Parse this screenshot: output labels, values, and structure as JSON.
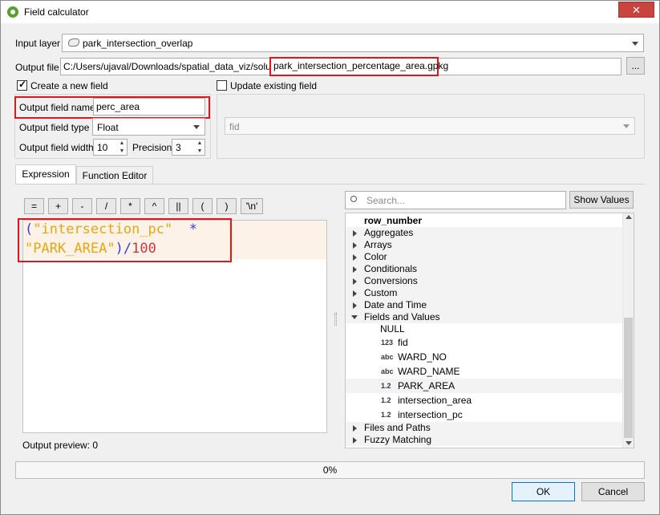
{
  "window": {
    "title": "Field calculator",
    "close_glyph": "✕"
  },
  "input_layer": {
    "label": "Input layer",
    "value": "park_intersection_overlap"
  },
  "output_file": {
    "label": "Output file",
    "path_prefix": "C:/Users/ujaval/Downloads/spatial_data_viz/solutions/",
    "file_name": "park_intersection_percentage_area.gpkg",
    "browse_label": "..."
  },
  "create_field": {
    "label": "Create a new field",
    "checked": true
  },
  "update_field": {
    "label": "Update existing field",
    "checked": false,
    "combo_value": "fid"
  },
  "output_field_name": {
    "label": "Output field name",
    "value": "perc_area"
  },
  "output_field_type": {
    "label": "Output field type",
    "value": "Float"
  },
  "output_field_width": {
    "label": "Output field width",
    "value": "10"
  },
  "precision": {
    "label": "Precision",
    "value": "3"
  },
  "tabs": [
    {
      "label": "Expression",
      "active": true
    },
    {
      "label": "Function Editor",
      "active": false
    }
  ],
  "operators": [
    "=",
    "+",
    "-",
    "/",
    "*",
    "^",
    "||",
    "(",
    ")",
    "'\\n'"
  ],
  "expression": {
    "line1_open": "(",
    "line1_field": "\"intersection_pc\"",
    "line1_op": "  *",
    "line2_field": "\"PARK_AREA\"",
    "line2_close": ")",
    "line2_op": "/",
    "line2_num": "100",
    "colors": {
      "field": "#e3a812",
      "operator": "#3b3bd6",
      "number": "#c43c3c",
      "highlight": "#fdf2e8"
    }
  },
  "output_preview": {
    "label": "Output preview:",
    "value": "0"
  },
  "search": {
    "placeholder": "Search...",
    "show_values_label": "Show Values"
  },
  "tree": {
    "top_item": "row_number",
    "groups_before": [
      "Aggregates",
      "Arrays",
      "Color",
      "Conditionals",
      "Conversions",
      "Custom",
      "Date and Time"
    ],
    "expanded_group": "Fields and Values",
    "fields": [
      {
        "badge": "",
        "name": "NULL"
      },
      {
        "badge": "123",
        "name": "fid"
      },
      {
        "badge": "abc",
        "name": "WARD_NO"
      },
      {
        "badge": "abc",
        "name": "WARD_NAME"
      },
      {
        "badge": "1.2",
        "name": "PARK_AREA"
      },
      {
        "badge": "1.2",
        "name": "intersection_area"
      },
      {
        "badge": "1.2",
        "name": "intersection_pc"
      }
    ],
    "groups_after": [
      "Files and Paths",
      "Fuzzy Matching"
    ]
  },
  "progress": {
    "value_percent": 0,
    "label": "0%"
  },
  "buttons": {
    "ok": "OK",
    "cancel": "Cancel"
  },
  "colors": {
    "accent": "#0078d7",
    "highlight_box": "#e0161b",
    "title_close": "#c7453e",
    "qgis_green": "#5aa02c"
  }
}
